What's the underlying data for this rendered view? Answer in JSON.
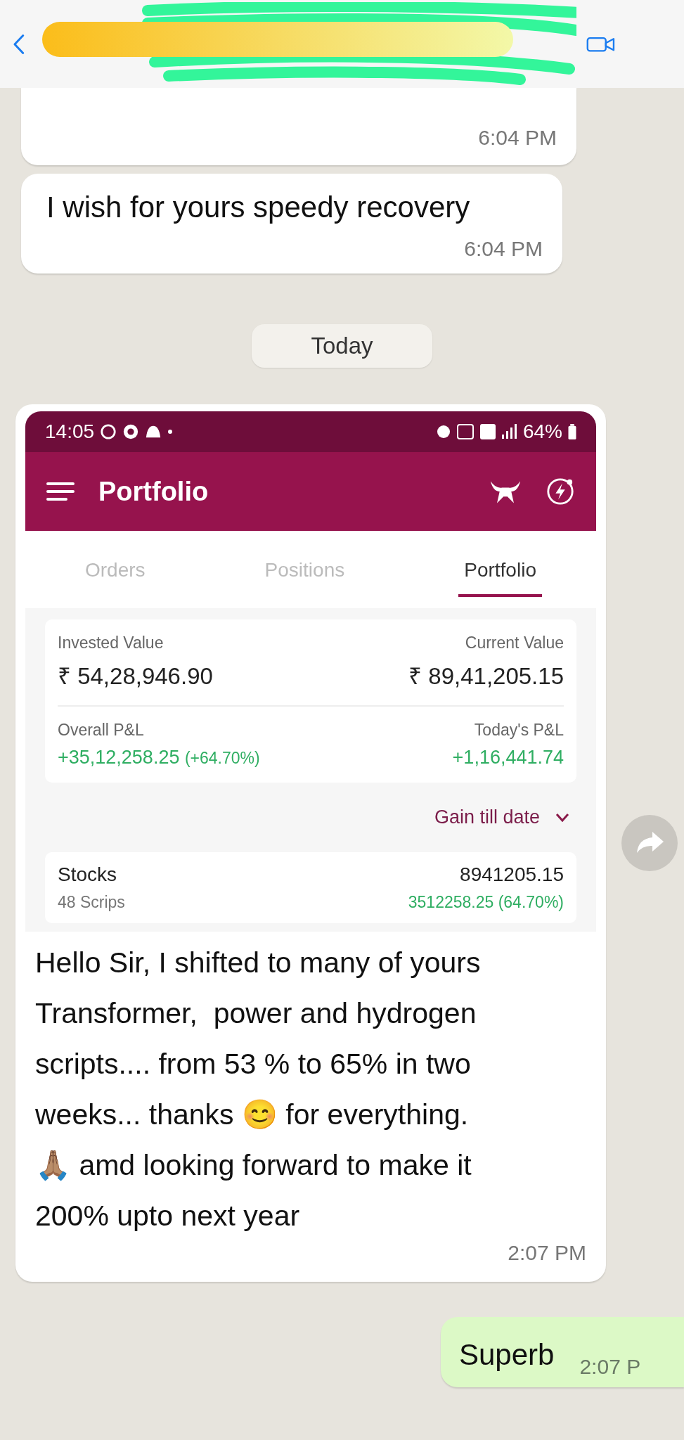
{
  "messages": [
    {
      "kind": "incoming",
      "time": "6:04 PM"
    },
    {
      "kind": "incoming",
      "text": "I wish for yours speedy recovery",
      "time": "6:04 PM"
    },
    {
      "kind": "date",
      "text": "Today"
    },
    {
      "kind": "image",
      "time": "2:07 PM",
      "caption": "Hello Sir, I shifted to many of yours\nTransformer,  power and hydrogen\nscripts.... from 53 % to 65% in two\nweeks... thanks 😊 for everything.\n🙏🏽 amd looking forward to make it\n200% upto next year",
      "screenshot": {
        "status_time": "14:05",
        "battery": "64%",
        "title": "Portfolio",
        "tabs": [
          {
            "label": "Orders",
            "selected": false
          },
          {
            "label": "Positions",
            "selected": false
          },
          {
            "label": "Portfolio",
            "selected": true
          }
        ],
        "invested": {
          "label": "Invested Value",
          "value": "₹ 54,28,946.90"
        },
        "current": {
          "label": "Current Value",
          "value": "₹ 89,41,205.15"
        },
        "overall_pnl": {
          "label": "Overall P&L",
          "value": "+35,12,258.25",
          "percent": "(+64.70%)"
        },
        "todays_pnl": {
          "label": "Today's P&L",
          "value": "+1,16,441.74"
        },
        "filter": "Gain till date",
        "holding": {
          "name": "Stocks",
          "count": "48 Scrips",
          "value": "8941205.15",
          "pnl": "3512258.25 (64.70%)"
        }
      }
    },
    {
      "kind": "outgoing",
      "text": "Superb",
      "time": "2:07 P"
    }
  ]
}
